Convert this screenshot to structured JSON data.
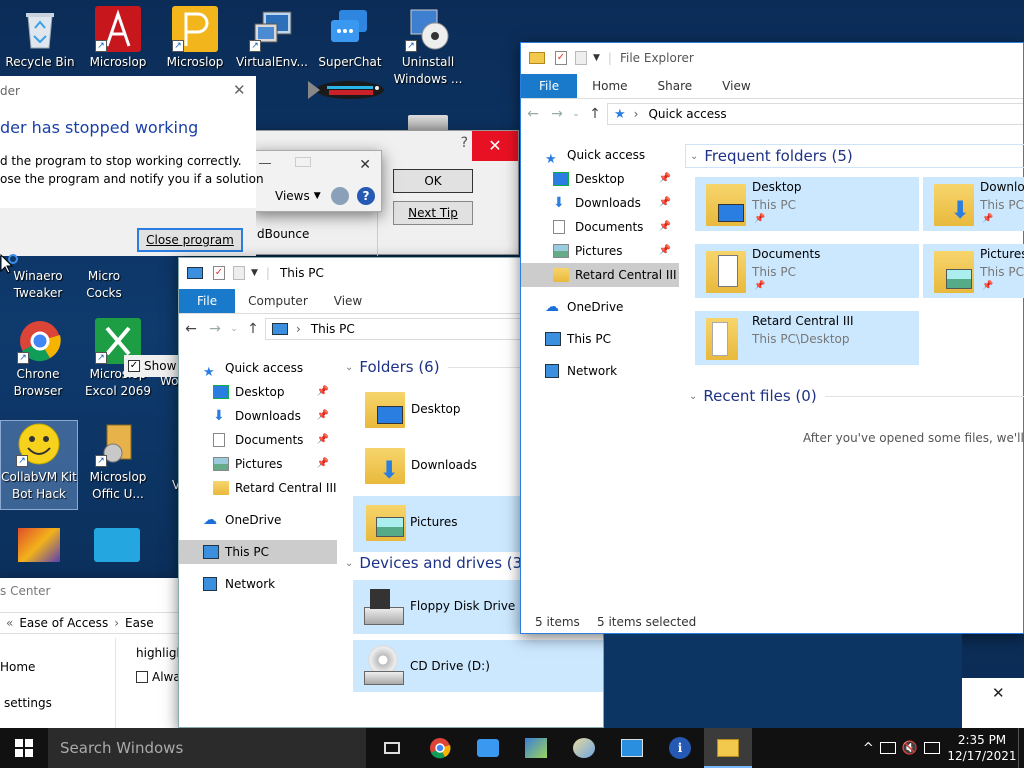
{
  "desktop": {
    "icons": [
      {
        "label": "Recycle Bin",
        "name": "recycle-bin-icon"
      },
      {
        "label": "Microslop",
        "name": "microslop-access-icon"
      },
      {
        "label": "Microslop",
        "name": "microslop-publisher-icon"
      },
      {
        "label": "VirtualEnv...",
        "name": "virtualenv-icon"
      },
      {
        "label": "SuperChat",
        "name": "superchat-icon"
      },
      {
        "label": "Uninstall Windows ...",
        "name": "uninstall-windows-icon"
      },
      {
        "label": "Winaero Tweaker",
        "name": "winaero-tweaker-icon"
      },
      {
        "label": "Micro Cocks",
        "name": "micro-cocks-icon"
      },
      {
        "label": "Chrone Browser",
        "name": "chrone-browser-icon"
      },
      {
        "label": "Microslop Excol 2069",
        "name": "microslop-excol-icon"
      },
      {
        "label": "CollabVM Kit Bot Hack",
        "name": "collabvm-kit-icon"
      },
      {
        "label": "Microslop Offic U...",
        "name": "microslop-office-icon"
      }
    ],
    "partial_labels": {
      "w1": "Wo",
      "w2": "V"
    }
  },
  "error_dialog": {
    "title_fragment": "der",
    "heading": "der has stopped working",
    "line1": "d the program to stop working correctly.",
    "line2": "ose the program and notify you if a solution",
    "close_button": "Close program"
  },
  "tip_dialog": {
    "ok": "OK",
    "next_tip": "Next Tip",
    "help": "?",
    "text_fragment": "dBounce",
    "views": "Views",
    "show_label": "Show"
  },
  "ease_window": {
    "title_fragment": "s Center",
    "breadcrumb1": "Ease of Access",
    "breadcrumb2": "Ease",
    "nav_home": "Home",
    "nav_settings": "settings",
    "content1": "highligh",
    "content2": "Alwa"
  },
  "this_pc": {
    "title": "This PC",
    "tabs": [
      "File",
      "Computer",
      "View"
    ],
    "address": "This PC",
    "nav": {
      "quick_access": "Quick access",
      "desktop": "Desktop",
      "downloads": "Downloads",
      "documents": "Documents",
      "pictures": "Pictures",
      "retard": "Retard Central III",
      "onedrive": "OneDrive",
      "this_pc": "This PC",
      "network": "Network"
    },
    "folders_header": "Folders (6)",
    "folders": [
      "Desktop",
      "Downloads",
      "Pictures"
    ],
    "drives_header": "Devices and drives (3)",
    "drives": [
      "Floppy Disk Drive (A",
      "CD Drive (D:)"
    ]
  },
  "file_explorer": {
    "title": "File Explorer",
    "tabs": [
      "File",
      "Home",
      "Share",
      "View"
    ],
    "address": "Quick access",
    "nav": {
      "quick_access": "Quick access",
      "desktop": "Desktop",
      "downloads": "Downloads",
      "documents": "Documents",
      "pictures": "Pictures",
      "retard": "Retard Central III",
      "onedrive": "OneDrive",
      "this_pc": "This PC",
      "network": "Network"
    },
    "frequent_header": "Frequent folders (5)",
    "frequent": [
      {
        "name": "Desktop",
        "sub": "This PC"
      },
      {
        "name": "Downloa",
        "sub": "This PC"
      },
      {
        "name": "Documents",
        "sub": "This PC"
      },
      {
        "name": "Pictures",
        "sub": "This PC"
      },
      {
        "name": "Retard Central III",
        "sub": "This PC\\Desktop"
      }
    ],
    "recent_header": "Recent files (0)",
    "recent_empty": "After you've opened some files, we'll sho",
    "status_items": "5 items",
    "status_selected": "5 items selected"
  },
  "taskbar": {
    "search_placeholder": "Search Windows",
    "time": "2:35 PM",
    "date": "12/17/2021"
  }
}
